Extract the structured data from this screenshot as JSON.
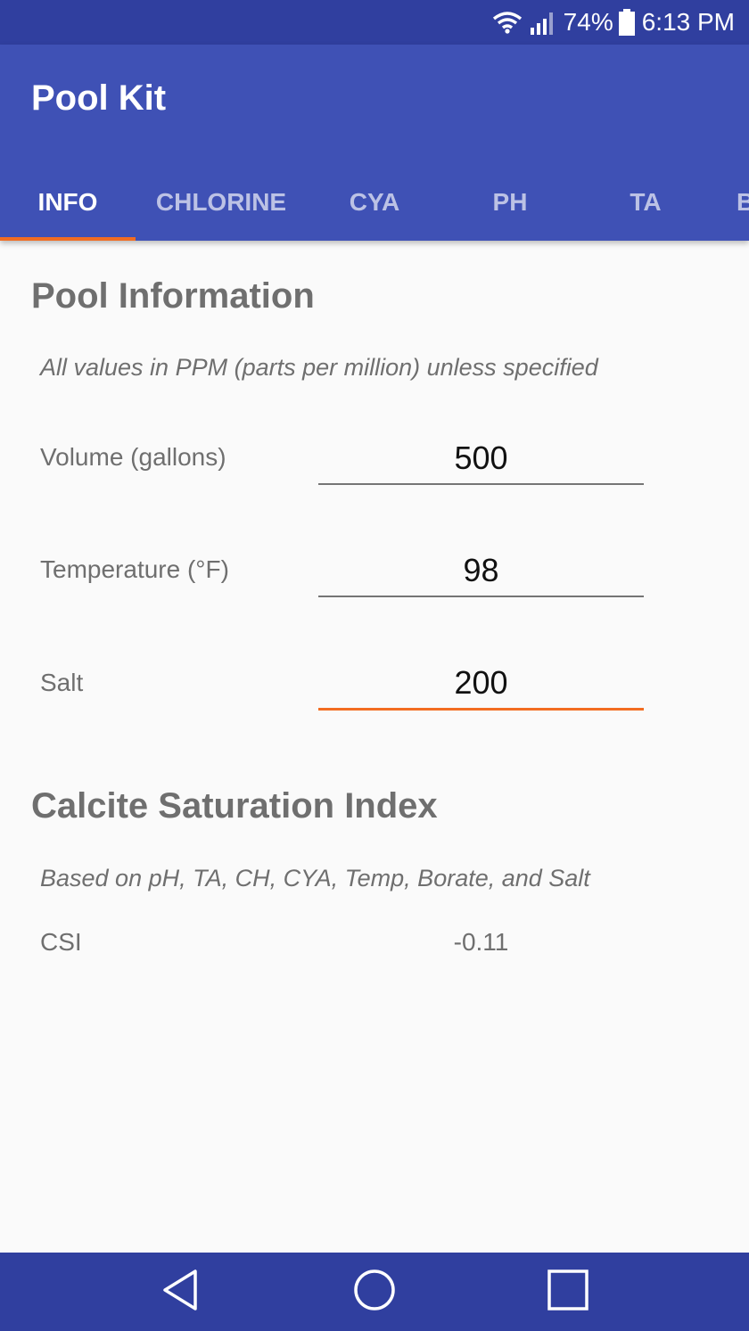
{
  "status_bar": {
    "battery_percent": "74%",
    "time": "6:13 PM",
    "icons": [
      "wifi-icon",
      "signal-icon",
      "battery-icon"
    ]
  },
  "app_bar": {
    "title": "Pool Kit",
    "tabs": [
      {
        "label": "INFO",
        "active": true
      },
      {
        "label": "CHLORINE",
        "active": false
      },
      {
        "label": "CYA",
        "active": false
      },
      {
        "label": "PH",
        "active": false
      },
      {
        "label": "TA",
        "active": false
      },
      {
        "label": "B",
        "active": false
      }
    ]
  },
  "pool_info": {
    "title": "Pool Information",
    "subtitle": "All values in PPM (parts per million) unless specified",
    "fields": [
      {
        "label": "Volume (gallons)",
        "value": "500"
      },
      {
        "label": "Temperature (°F)",
        "value": "98"
      },
      {
        "label": "Salt",
        "value": "200"
      }
    ]
  },
  "csi": {
    "title": "Calcite Saturation Index",
    "subtitle": "Based on pH, TA, CH, CYA, Temp, Borate, and Salt",
    "label": "CSI",
    "value": "-0.11"
  },
  "nav_bar": {
    "icons": [
      "back-icon",
      "home-icon",
      "recents-icon"
    ]
  },
  "colors": {
    "primary": "#3f51b5",
    "primary_dark": "#303f9f",
    "accent": "#f26c21"
  }
}
